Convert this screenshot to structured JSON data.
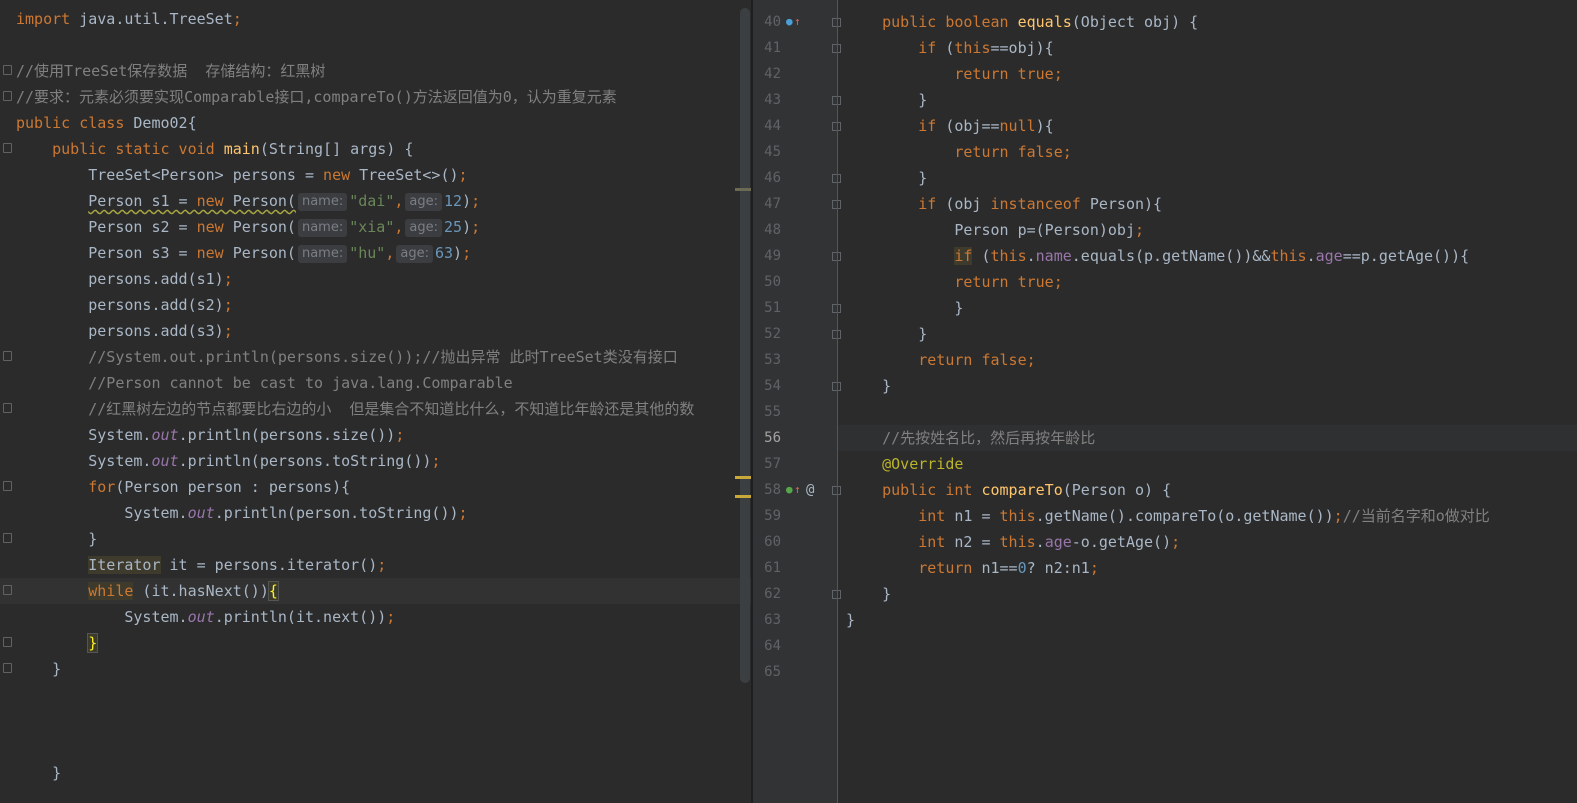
{
  "left": {
    "lines": [
      {
        "segs": [
          [
            "kw",
            "import "
          ],
          [
            "",
            "java.util.TreeSet"
          ],
          [
            "kw",
            ";"
          ]
        ]
      },
      {
        "segs": []
      },
      {
        "segs": [
          [
            "cmt",
            "//使用TreeSet保存数据  存储结构：红黑树"
          ]
        ]
      },
      {
        "segs": [
          [
            "cmt",
            "//要求：元素必须要实现Comparable接口,compareTo()方法返回值为0，认为重复元素"
          ]
        ]
      },
      {
        "segs": [
          [
            "kw",
            "public class "
          ],
          [
            "",
            "Demo02{"
          ]
        ]
      },
      {
        "segs": [
          [
            "",
            "    "
          ],
          [
            "kw",
            "public static void "
          ],
          [
            "fn",
            "main"
          ],
          [
            "",
            "(String[] args) {"
          ]
        ]
      },
      {
        "segs": [
          [
            "",
            "        TreeSet<Person> persons = "
          ],
          [
            "kw",
            "new "
          ],
          [
            "",
            "TreeSet<>()"
          ],
          [
            "kw",
            ";"
          ]
        ]
      },
      {
        "segs": [
          [
            "",
            "        "
          ],
          [
            "warn",
            "Person s1 = "
          ],
          [
            "kwwarn",
            "new "
          ],
          [
            "warn",
            "Person("
          ],
          [
            "hint",
            "name:"
          ],
          [
            "str",
            "\"dai\""
          ],
          [
            "kw",
            ","
          ],
          [
            "hint",
            "age:"
          ],
          [
            "num",
            "12"
          ],
          [
            "",
            ")"
          ],
          [
            "kw",
            ";"
          ]
        ]
      },
      {
        "segs": [
          [
            "",
            "        Person s2 = "
          ],
          [
            "kw",
            "new "
          ],
          [
            "",
            "Person("
          ],
          [
            "hint",
            "name:"
          ],
          [
            "str",
            "\"xia\""
          ],
          [
            "kw",
            ","
          ],
          [
            "hint",
            "age:"
          ],
          [
            "num",
            "25"
          ],
          [
            "",
            ")"
          ],
          [
            "kw",
            ";"
          ]
        ]
      },
      {
        "segs": [
          [
            "",
            "        Person s3 = "
          ],
          [
            "kw",
            "new "
          ],
          [
            "",
            "Person("
          ],
          [
            "hint",
            "name:"
          ],
          [
            "str",
            "\"hu\""
          ],
          [
            "kw",
            ","
          ],
          [
            "hint",
            "age:"
          ],
          [
            "num",
            "63"
          ],
          [
            "",
            ")"
          ],
          [
            "kw",
            ";"
          ]
        ]
      },
      {
        "segs": [
          [
            "",
            "        persons.add(s1)"
          ],
          [
            "kw",
            ";"
          ]
        ]
      },
      {
        "segs": [
          [
            "",
            "        persons.add(s2)"
          ],
          [
            "kw",
            ";"
          ]
        ]
      },
      {
        "segs": [
          [
            "",
            "        persons.add(s3)"
          ],
          [
            "kw",
            ";"
          ]
        ]
      },
      {
        "segs": [
          [
            "",
            "        "
          ],
          [
            "cmt",
            "//System.out.println(persons.size());//抛出异常 此时TreeSet类没有接口"
          ]
        ]
      },
      {
        "segs": [
          [
            "",
            "        "
          ],
          [
            "cmt",
            "//Person cannot be cast to java.lang.Comparable"
          ]
        ]
      },
      {
        "segs": [
          [
            "",
            "        "
          ],
          [
            "cmt",
            "//红黑树左边的节点都要比右边的小  但是集合不知道比什么，不知道比年龄还是其他的数"
          ]
        ]
      },
      {
        "segs": [
          [
            "",
            "        System."
          ],
          [
            "static",
            "out"
          ],
          [
            "",
            ".println(persons.size())"
          ],
          [
            "kw",
            ";"
          ]
        ]
      },
      {
        "segs": [
          [
            "",
            "        System."
          ],
          [
            "static",
            "out"
          ],
          [
            "",
            ".println(persons.toString())"
          ],
          [
            "kw",
            ";"
          ]
        ]
      },
      {
        "segs": [
          [
            "",
            "        "
          ],
          [
            "kw",
            "for"
          ],
          [
            "",
            "(Person person : persons){"
          ]
        ]
      },
      {
        "segs": [
          [
            "",
            "            System."
          ],
          [
            "static",
            "out"
          ],
          [
            "",
            ".println(person.toString())"
          ],
          [
            "kw",
            ";"
          ]
        ]
      },
      {
        "segs": [
          [
            "",
            "        }"
          ]
        ]
      },
      {
        "segs": [
          [
            "",
            "        "
          ],
          [
            "ref",
            "Iterator"
          ],
          [
            "",
            " it = persons.iterator()"
          ],
          [
            "kw",
            ";"
          ]
        ]
      },
      {
        "segs": [
          [
            "",
            "        "
          ],
          [
            "kwref",
            "while"
          ],
          [
            "",
            " (it.hasNext())"
          ],
          [
            "brace",
            "{"
          ]
        ]
      },
      {
        "segs": [
          [
            "",
            "            System."
          ],
          [
            "static",
            "out"
          ],
          [
            "",
            ".println(it.next())"
          ],
          [
            "kw",
            ";"
          ]
        ]
      },
      {
        "segs": [
          [
            "",
            "        "
          ],
          [
            "brace",
            "}"
          ]
        ]
      },
      {
        "segs": [
          [
            "",
            "    }"
          ]
        ]
      },
      {
        "segs": []
      },
      {
        "segs": []
      },
      {
        "segs": []
      },
      {
        "segs": [
          [
            "",
            "    }"
          ]
        ]
      }
    ]
  },
  "right": {
    "first_line_number": 40,
    "current_line": 56,
    "lines": [
      {
        "segs": [
          [
            "",
            "    "
          ],
          [
            "kw",
            "public boolean "
          ],
          [
            "fn",
            "equals"
          ],
          [
            "",
            "(Object obj) {"
          ]
        ]
      },
      {
        "segs": [
          [
            "",
            "        "
          ],
          [
            "kw",
            "if "
          ],
          [
            "",
            "("
          ],
          [
            "kw",
            "this"
          ],
          [
            "",
            "==obj){"
          ]
        ]
      },
      {
        "segs": [
          [
            "",
            "            "
          ],
          [
            "kw",
            "return true;"
          ]
        ]
      },
      {
        "segs": [
          [
            "",
            "        }"
          ]
        ]
      },
      {
        "segs": [
          [
            "",
            "        "
          ],
          [
            "kw",
            "if "
          ],
          [
            "",
            "(obj=="
          ],
          [
            "kw",
            "null"
          ],
          [
            "",
            "){"
          ]
        ]
      },
      {
        "segs": [
          [
            "",
            "            "
          ],
          [
            "kw",
            "return false;"
          ]
        ]
      },
      {
        "segs": [
          [
            "",
            "        }"
          ]
        ]
      },
      {
        "segs": [
          [
            "",
            "        "
          ],
          [
            "kw",
            "if "
          ],
          [
            "",
            "(obj "
          ],
          [
            "kw",
            "instanceof "
          ],
          [
            "",
            "Person){"
          ]
        ]
      },
      {
        "segs": [
          [
            "",
            "            Person p=(Person)obj"
          ],
          [
            "kw",
            ";"
          ]
        ]
      },
      {
        "segs": [
          [
            "",
            "            "
          ],
          [
            "kwref",
            "if"
          ],
          [
            "",
            " ("
          ],
          [
            "kw",
            "this"
          ],
          [
            "",
            "."
          ],
          [
            "field",
            "name"
          ],
          [
            "",
            ".equals(p.getName())&&"
          ],
          [
            "kw",
            "this"
          ],
          [
            "",
            "."
          ],
          [
            "field",
            "age"
          ],
          [
            "",
            "==p.getAge()){"
          ]
        ]
      },
      {
        "segs": [
          [
            "",
            "            "
          ],
          [
            "kw",
            "return true;"
          ]
        ]
      },
      {
        "segs": [
          [
            "",
            "            }"
          ]
        ]
      },
      {
        "segs": [
          [
            "",
            "        }"
          ]
        ]
      },
      {
        "segs": [
          [
            "",
            "        "
          ],
          [
            "kw",
            "return false;"
          ]
        ]
      },
      {
        "segs": [
          [
            "",
            "    }"
          ]
        ]
      },
      {
        "segs": []
      },
      {
        "segs": [
          [
            "",
            "    "
          ],
          [
            "cmt",
            "//先按姓名比，然后再按年龄比"
          ]
        ]
      },
      {
        "segs": [
          [
            "",
            "    "
          ],
          [
            "ann",
            "@Override"
          ]
        ]
      },
      {
        "segs": [
          [
            "",
            "    "
          ],
          [
            "kw",
            "public int "
          ],
          [
            "fn",
            "compareTo"
          ],
          [
            "",
            "(Person o) {"
          ]
        ]
      },
      {
        "segs": [
          [
            "",
            "        "
          ],
          [
            "kw",
            "int "
          ],
          [
            "",
            "n1 = "
          ],
          [
            "kw",
            "this"
          ],
          [
            "",
            ".getName().compareTo(o.getName())"
          ],
          [
            "kw",
            ";"
          ],
          [
            "cmt",
            "//当前名字和o做对比"
          ]
        ]
      },
      {
        "segs": [
          [
            "",
            "        "
          ],
          [
            "kw",
            "int "
          ],
          [
            "",
            "n2 = "
          ],
          [
            "kw",
            "this"
          ],
          [
            "",
            "."
          ],
          [
            "field",
            "age"
          ],
          [
            "",
            "-o.getAge()"
          ],
          [
            "kw",
            ";"
          ]
        ]
      },
      {
        "segs": [
          [
            "",
            "        "
          ],
          [
            "kw",
            "return "
          ],
          [
            "",
            "n1=="
          ],
          [
            "num",
            "0"
          ],
          [
            "",
            "? n2:n1"
          ],
          [
            "kw",
            ";"
          ]
        ]
      },
      {
        "segs": [
          [
            "",
            "    }"
          ]
        ]
      },
      {
        "segs": [
          [
            "",
            "}"
          ]
        ]
      },
      {
        "segs": []
      },
      {
        "segs": []
      }
    ],
    "top_partial": "@Override",
    "gutter_icons": {
      "line40": "override-up-icon",
      "line58": "implements-up-icon",
      "line58_at": "@"
    }
  },
  "colors": {
    "background": "#2b2b2b",
    "keyword": "#cc7832",
    "string": "#6a8759",
    "number": "#6897bb",
    "comment": "#808080",
    "function": "#ffc66d",
    "annotation": "#bbb529",
    "field": "#9876aa"
  }
}
